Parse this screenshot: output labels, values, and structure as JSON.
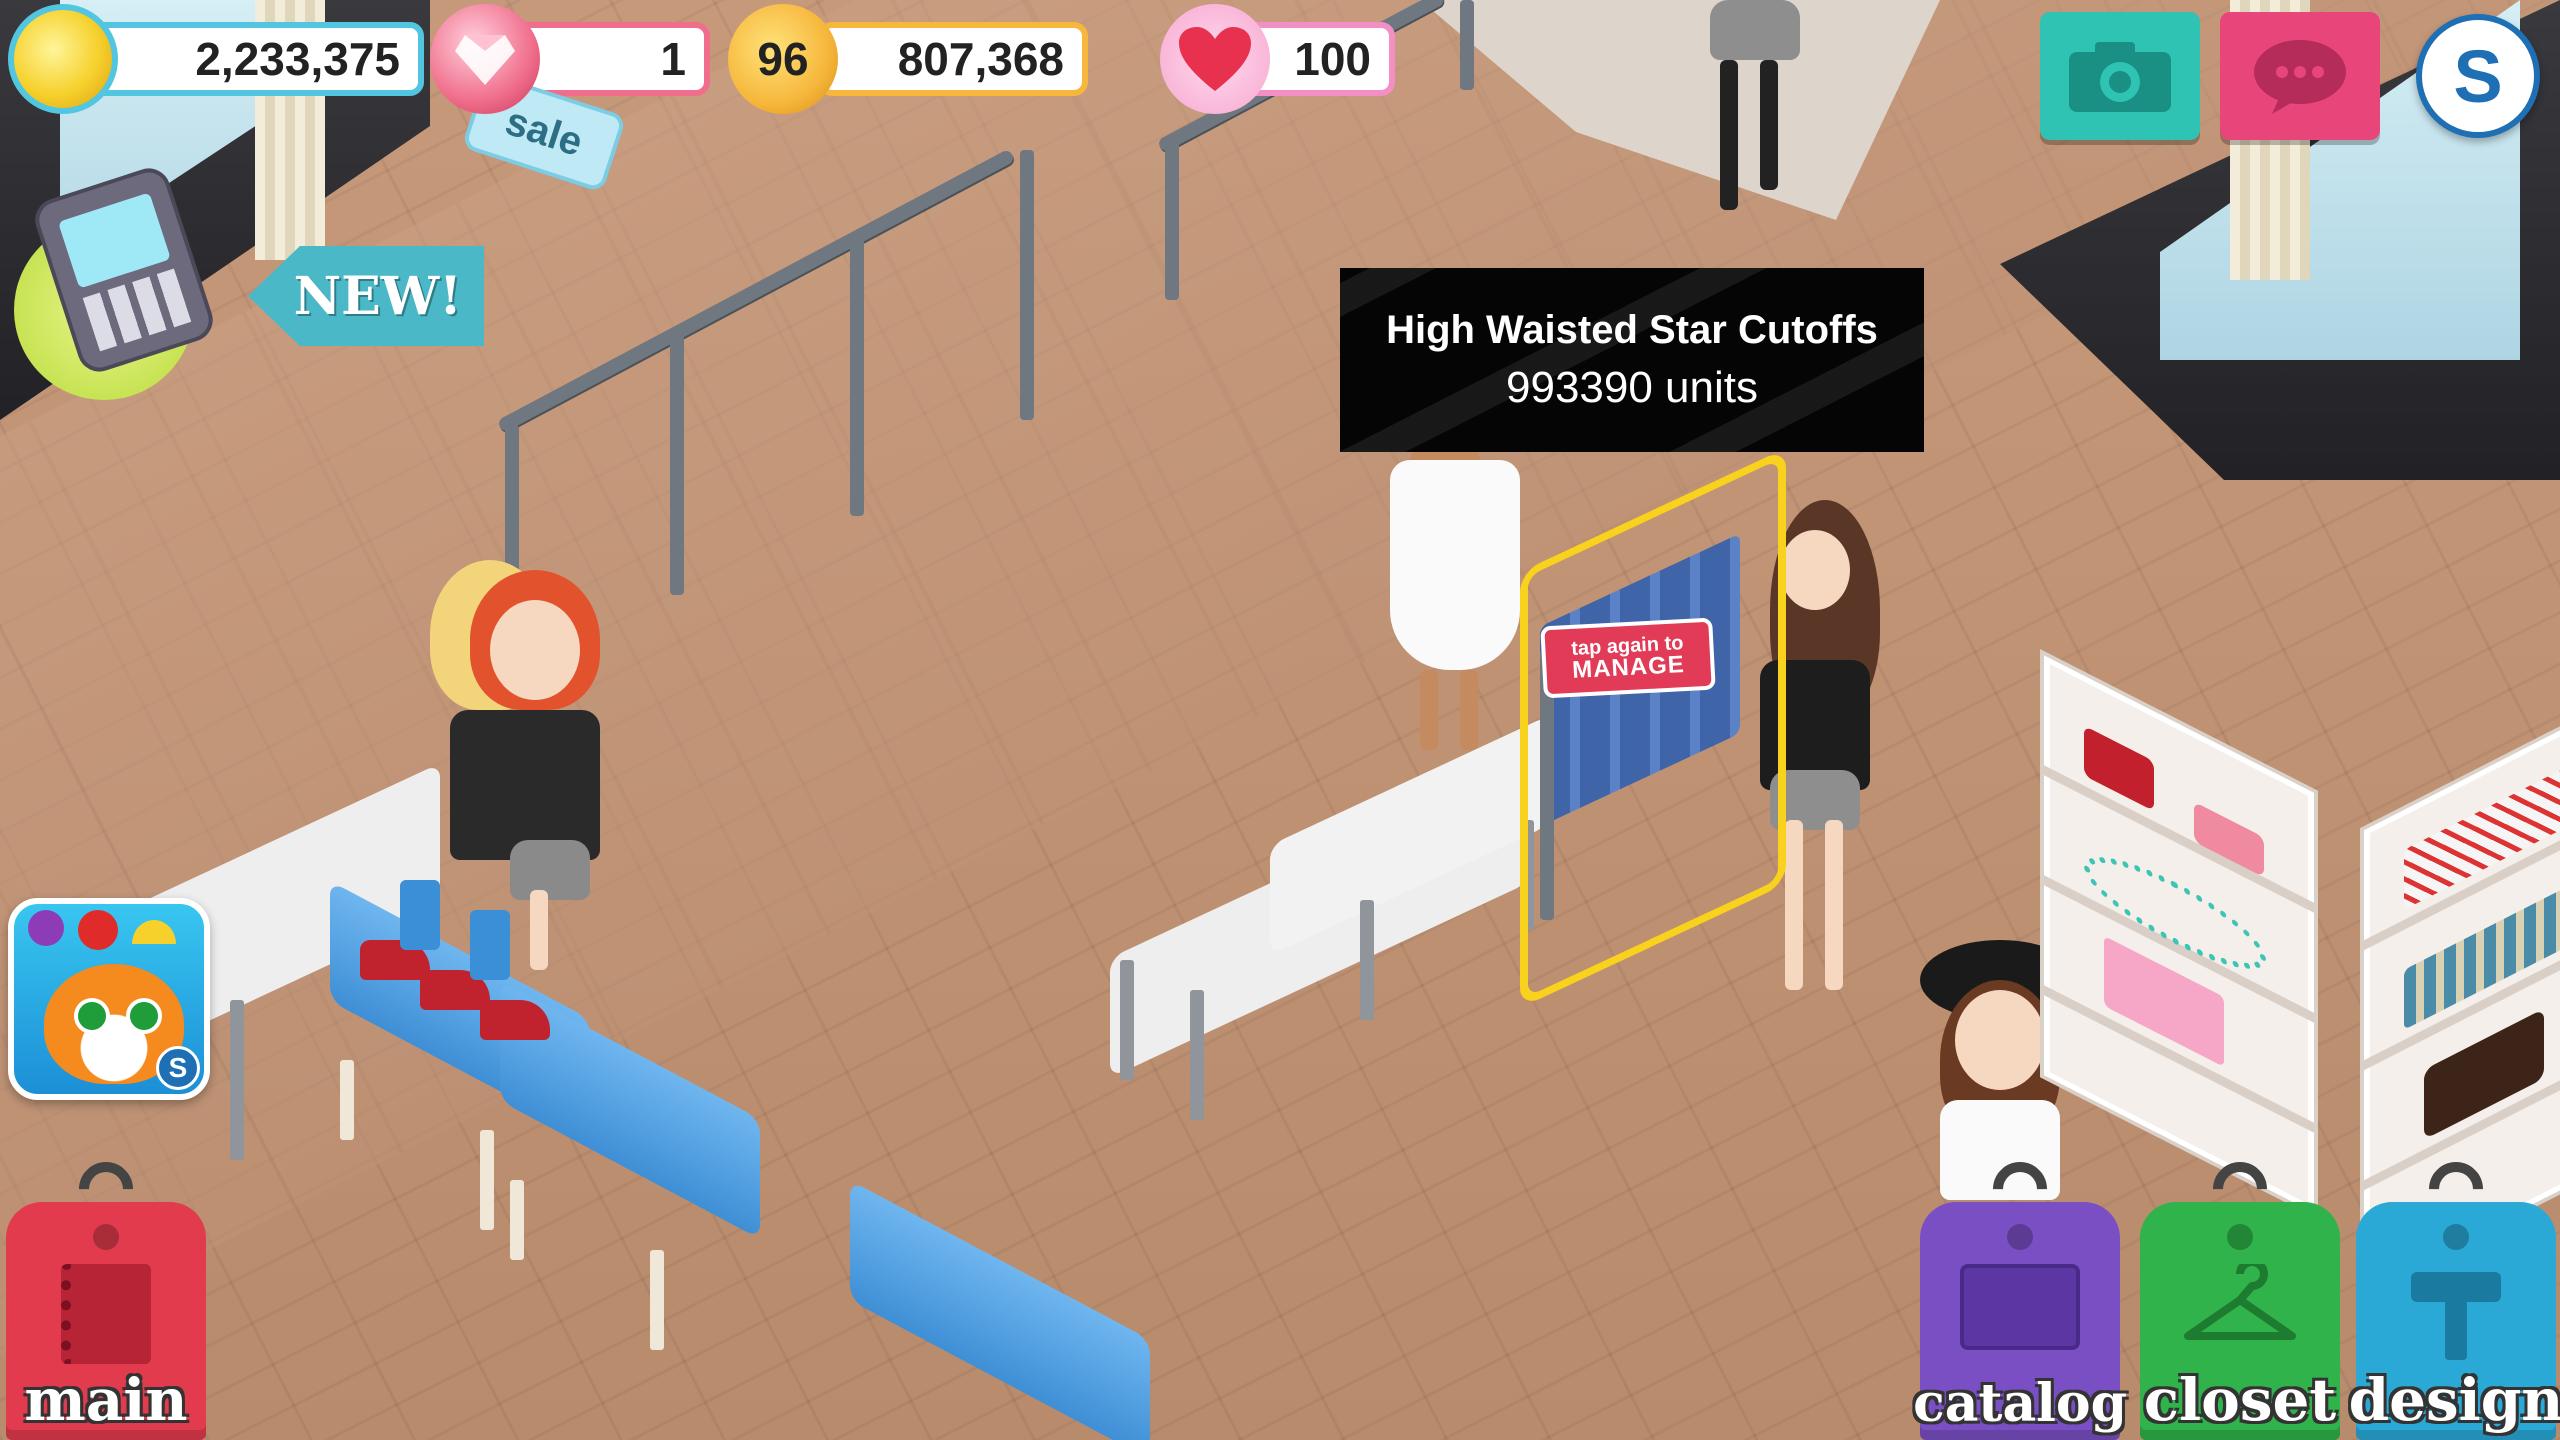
{
  "hud": {
    "coins": "2,233,375",
    "gems": "1",
    "level": "96",
    "xp": "807,368",
    "energy": "100",
    "sale_tag": "sale",
    "new_banner": "NEW!",
    "store_symbol": "S"
  },
  "tooltip": {
    "item_name": "High Waisted Star Cutoffs",
    "units": "993390 units"
  },
  "rack_sign": {
    "line1": "tap again to",
    "line2": "MANAGE"
  },
  "promo": {
    "badge": "S"
  },
  "nav": {
    "main": "main",
    "catalog": "catalog",
    "closet": "closet",
    "design": "design"
  },
  "colors": {
    "coin_border": "#52c6e0",
    "gem_border": "#f06e8c",
    "xp_border": "#f6b73c",
    "heart_border": "#f48fc5",
    "camera_btn": "#2fc3b4",
    "chat_btn": "#e8457a",
    "main_tag": "#e23b4e",
    "catalog_tag": "#7a4fc4",
    "closet_tag": "#2fb34a",
    "design_tag": "#2aa8d6"
  }
}
